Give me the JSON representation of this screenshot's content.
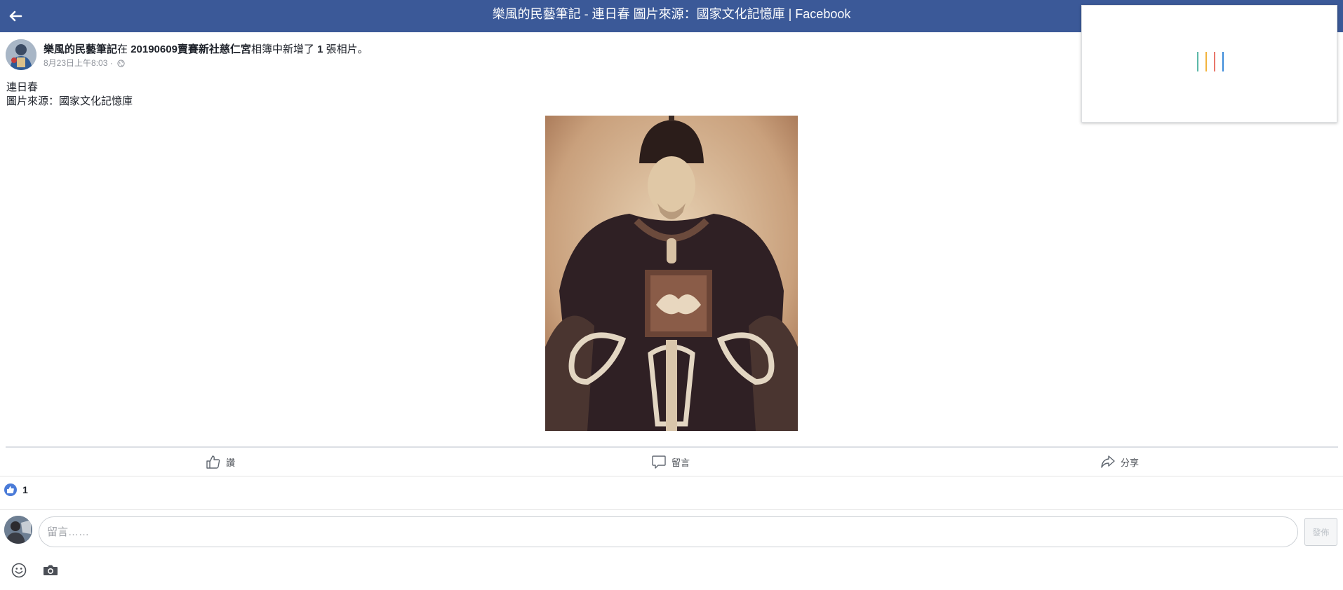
{
  "header": {
    "title": "樂風的民藝筆記 - 連日春 圖片來源：國家文化記憶庫 | Facebook",
    "back_icon": "arrow-left-icon",
    "background": "#3b5998"
  },
  "loading_popup": {
    "spinner_colors": [
      "#5cb8a8",
      "#f2b33d",
      "#e9766a",
      "#3b8ad9"
    ]
  },
  "post": {
    "author": "樂風的民藝筆記",
    "action_prefix": "在 ",
    "album": "20190609賣賽新社慈仁宮",
    "action_mid": "相簿中新增了 ",
    "count": "1",
    "action_suffix": " 張相片。",
    "timestamp": "8月23日上午8:03 ·",
    "privacy_icon": "globe-icon",
    "text_line1": "連日春",
    "text_line2": "圖片來源：國家文化記憶庫"
  },
  "actions": {
    "like_label": "讚",
    "comment_label": "留言",
    "share_label": "分享"
  },
  "reactions": {
    "like_count": "1"
  },
  "comment_box": {
    "placeholder": "留言……",
    "post_label": "發佈"
  },
  "composer_icons": [
    "smiley-icon",
    "camera-icon"
  ]
}
